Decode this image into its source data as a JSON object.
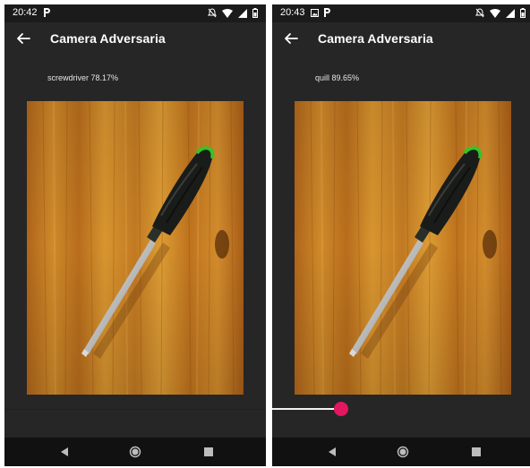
{
  "app": {
    "title": "Camera Adversaria"
  },
  "screens": [
    {
      "status": {
        "time": "20:42",
        "left_icons": [
          "p-app-icon"
        ],
        "right_icons": [
          "notifications-off-icon",
          "wifi-icon",
          "signal-icon",
          "battery-icon"
        ]
      },
      "title": "Camera Adversaria",
      "prediction": "screwdriver 78.17%",
      "photo_subject": "screwdriver-photo",
      "has_slider": false
    },
    {
      "status": {
        "time": "20:43",
        "left_icons": [
          "image-notification-icon",
          "p-app-icon"
        ],
        "right_icons": [
          "notifications-off-icon",
          "wifi-icon",
          "signal-icon",
          "battery-icon"
        ]
      },
      "title": "Camera Adversaria",
      "prediction": "quill 89.65%",
      "photo_subject": "screwdriver-photo",
      "has_slider": true,
      "slider_value": 0.26
    }
  ],
  "colors": {
    "background": "#262626",
    "status_bar": "#1b1b1b",
    "nav_bar": "#111111",
    "slider_accent": "#e2175f",
    "wood": "#c07a1c"
  },
  "nav": {
    "icons": [
      "nav-back-icon",
      "nav-home-icon",
      "nav-recents-icon"
    ]
  }
}
